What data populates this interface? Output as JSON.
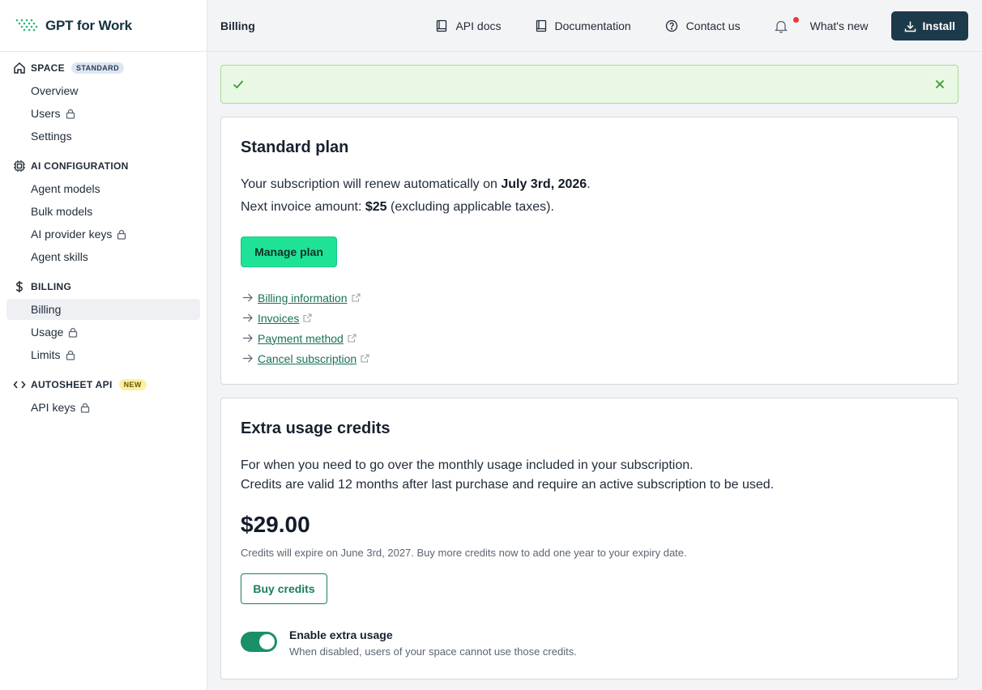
{
  "app": {
    "name": "GPT for Work"
  },
  "sidebar": {
    "sections": [
      {
        "title": "SPACE",
        "badge": "STANDARD",
        "icon": "home-icon",
        "items": [
          {
            "label": "Overview",
            "locked": false
          },
          {
            "label": "Users",
            "locked": true
          },
          {
            "label": "Settings",
            "locked": false
          }
        ]
      },
      {
        "title": "AI CONFIGURATION",
        "icon": "chip-icon",
        "items": [
          {
            "label": "Agent models",
            "locked": false
          },
          {
            "label": "Bulk models",
            "locked": false
          },
          {
            "label": "AI provider keys",
            "locked": true
          },
          {
            "label": "Agent skills",
            "locked": false
          }
        ]
      },
      {
        "title": "BILLING",
        "icon": "dollar-icon",
        "items": [
          {
            "label": "Billing",
            "locked": false,
            "active": true
          },
          {
            "label": "Usage",
            "locked": true
          },
          {
            "label": "Limits",
            "locked": true
          }
        ]
      },
      {
        "title": "AUTOSHEET API",
        "badge": "NEW",
        "icon": "code-icon",
        "items": [
          {
            "label": "API keys",
            "locked": true
          }
        ]
      }
    ]
  },
  "topbar": {
    "page": "Billing",
    "api_docs": "API docs",
    "documentation": "Documentation",
    "contact": "Contact us",
    "whats_new": "What's new",
    "install": "Install"
  },
  "plan": {
    "title": "Standard plan",
    "renew_prefix": "Your subscription will renew automatically on ",
    "renew_date": "July 3rd, 2026",
    "renew_suffix": ".",
    "invoice_prefix": "Next invoice amount: ",
    "invoice_amount": "$25",
    "invoice_suffix": " (excluding applicable taxes).",
    "manage_button": "Manage plan",
    "links": [
      "Billing information",
      "Invoices",
      "Payment method",
      "Cancel subscription"
    ]
  },
  "credits": {
    "title": "Extra usage credits",
    "desc_line1": "For when you need to go over the monthly usage included in your subscription.",
    "desc_line2": "Credits are valid 12 months after last purchase and require an active subscription to be used.",
    "amount": "$29.00",
    "expiry": "Credits will expire on June 3rd, 2027. Buy more credits now to add one year to your expiry date.",
    "buy_button": "Buy credits",
    "toggle_label": "Enable extra usage",
    "toggle_help": "When disabled, users of your space cannot use those credits.",
    "toggle_on": true
  },
  "colors": {
    "accent": "#1ee396",
    "brand_dark": "#1d3a4a",
    "link": "#18715a",
    "success_bg": "#e9f8e4"
  }
}
